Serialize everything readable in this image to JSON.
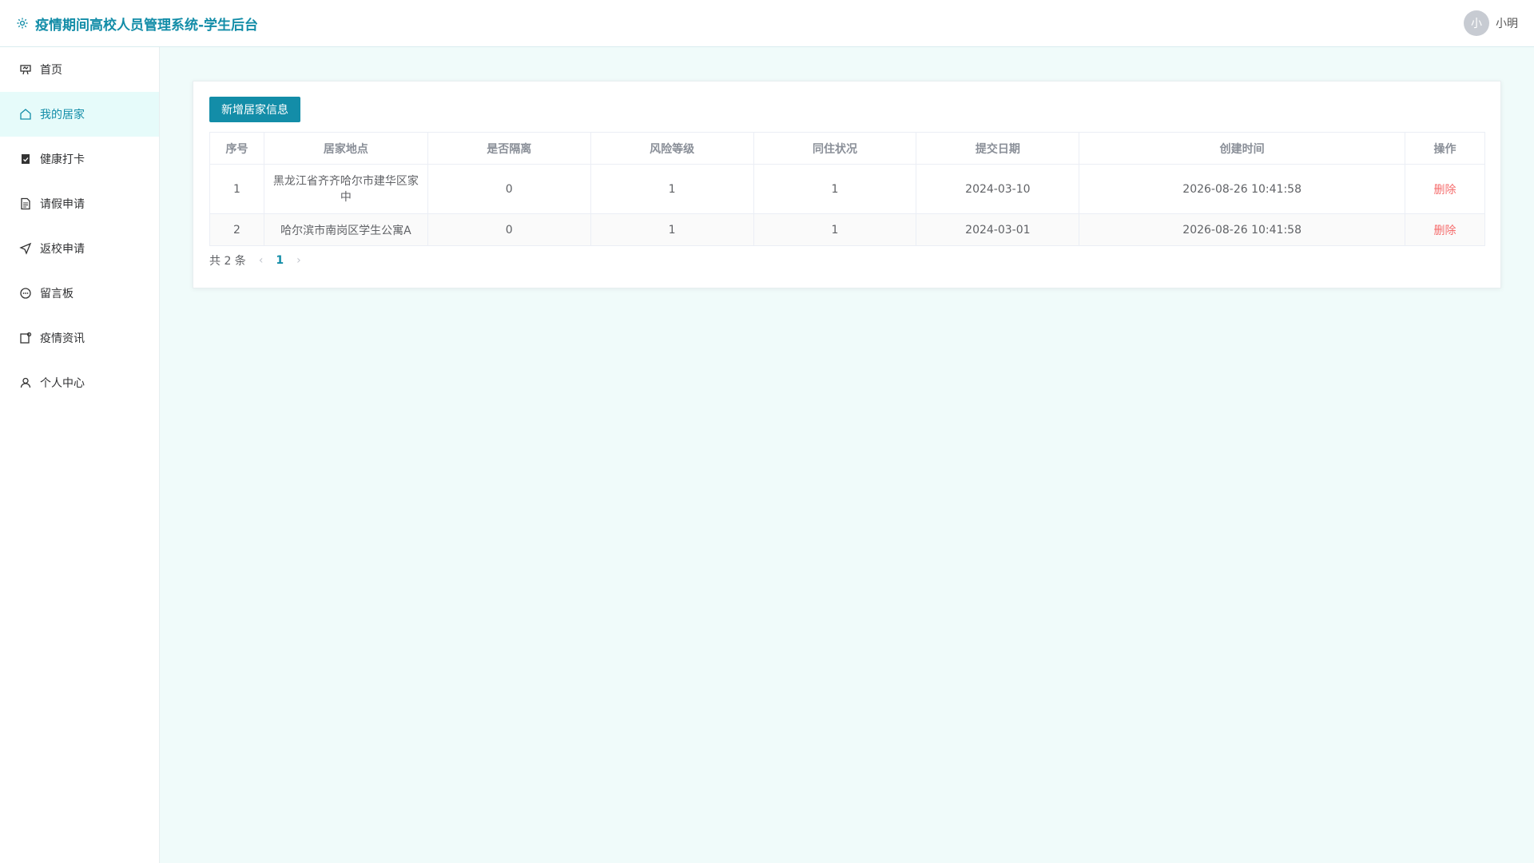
{
  "app": {
    "title": "疫情期间高校人员管理系统-学生后台",
    "brand_color": "#138da8"
  },
  "header": {
    "avatar_text": "小",
    "username": "小明"
  },
  "sidebar": {
    "items": [
      {
        "label": "首页",
        "icon": "presentation-icon"
      },
      {
        "label": "我的居家",
        "icon": "home-icon",
        "active": true
      },
      {
        "label": "健康打卡",
        "icon": "clipboard-check-icon"
      },
      {
        "label": "请假申请",
        "icon": "document-icon"
      },
      {
        "label": "返校申请",
        "icon": "send-icon"
      },
      {
        "label": "留言板",
        "icon": "chat-icon"
      },
      {
        "label": "疫情资讯",
        "icon": "news-icon"
      },
      {
        "label": "个人中心",
        "icon": "user-icon"
      }
    ]
  },
  "toolbar": {
    "add_label": "新增居家信息"
  },
  "table": {
    "headers": [
      "序号",
      "居家地点",
      "是否隔离",
      "风险等级",
      "同住状况",
      "提交日期",
      "创建时间",
      "操作"
    ],
    "rows": [
      {
        "index": "1",
        "address": "黑龙江省齐齐哈尔市建华区家中",
        "isolated": "0",
        "risk": "1",
        "cohabit": "1",
        "submit_date": "2024-03-10",
        "created": "2026-08-26 10:41:58",
        "action": "删除"
      },
      {
        "index": "2",
        "address": "哈尔滨市南岗区学生公寓A",
        "isolated": "0",
        "risk": "1",
        "cohabit": "1",
        "submit_date": "2024-03-01",
        "created": "2026-08-26 10:41:58",
        "action": "删除"
      }
    ]
  },
  "pagination": {
    "total_text": "共 2 条",
    "current_page": "1"
  }
}
